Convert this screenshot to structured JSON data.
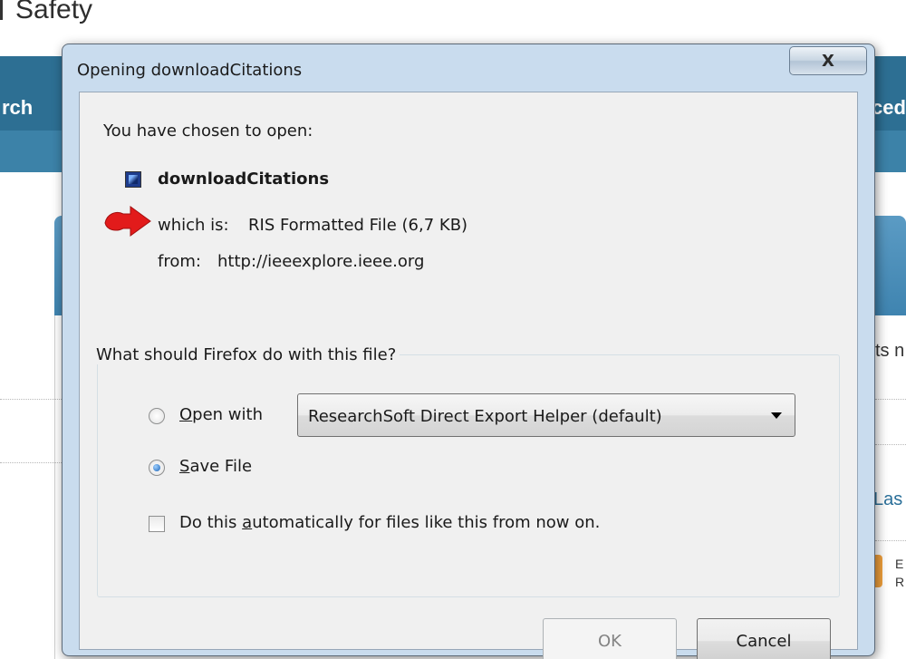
{
  "background": {
    "page_title": "Safety",
    "nav_left": "rch",
    "nav_right": "ced",
    "side_text_1": "ts n",
    "side_text_2": "Las",
    "side_text_3a": "E",
    "side_text_3b": "R"
  },
  "dialog": {
    "title": "Opening downloadCitations",
    "close_label": "X",
    "intro": "You have chosen to open:",
    "file_name": "downloadCitations",
    "which_is_label": "which is:",
    "file_type": "RIS Formatted File (6,7 KB)",
    "from_label": "from:",
    "source_url": "http://ieeexplore.ieee.org",
    "group_label": "What should Firefox do with this file?",
    "open_with": {
      "mnemonic": "O",
      "rest": "pen with",
      "checked": false
    },
    "app_select": {
      "value": "ResearchSoft Direct Export Helper (default)"
    },
    "save_file": {
      "mnemonic": "S",
      "rest": "ave File",
      "checked": true
    },
    "auto_checkbox": {
      "pre": "Do this ",
      "mnemonic": "a",
      "post": "utomatically for files like this from now on.",
      "checked": false
    },
    "ok_label": "OK",
    "cancel_label": "Cancel"
  },
  "colors": {
    "annotation_arrow": "#e21b1b",
    "nav_bar": "#2d6f93",
    "dialog_frame": "#c9dcee"
  }
}
